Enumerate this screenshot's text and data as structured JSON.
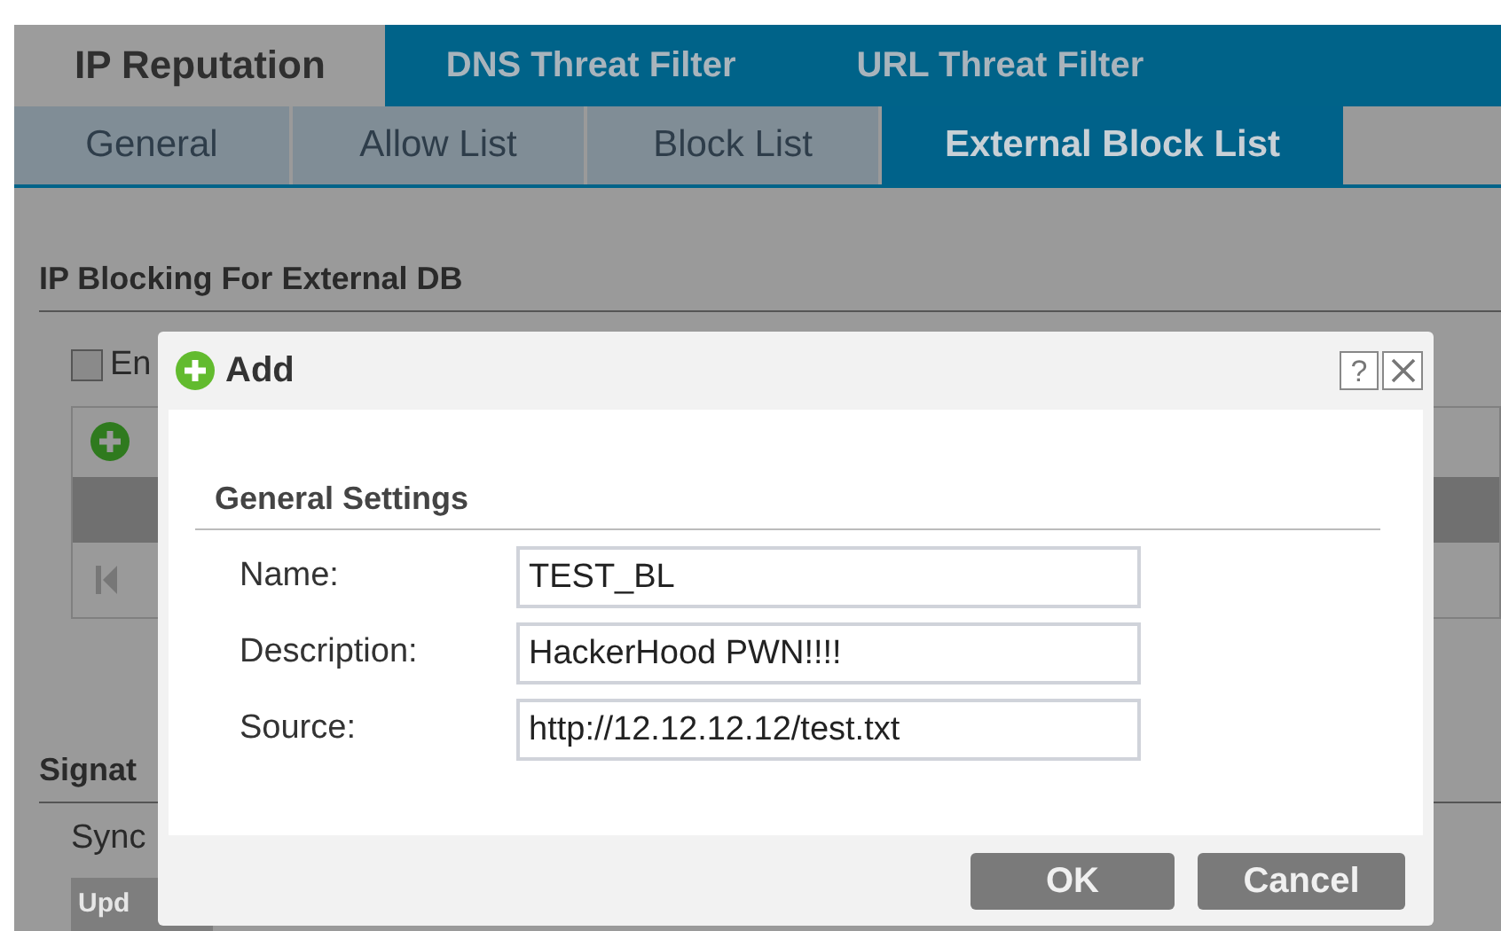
{
  "tabs": [
    {
      "label": "IP Reputation",
      "selected": true
    },
    {
      "label": "DNS Threat Filter",
      "selected": false
    },
    {
      "label": "URL Threat Filter",
      "selected": false
    }
  ],
  "subtabs": [
    {
      "label": "General",
      "selected": false
    },
    {
      "label": "Allow List",
      "selected": false
    },
    {
      "label": "Block List",
      "selected": false
    },
    {
      "label": "External Block List",
      "selected": true
    }
  ],
  "section": {
    "title": "IP Blocking For External DB",
    "enable": {
      "label": "En",
      "checked": false
    }
  },
  "section_2": {
    "title": "Signat",
    "sync_label": "Sync",
    "update_button": "Upd"
  },
  "dialog": {
    "title": "Add",
    "help": "?",
    "group_title": "General Settings",
    "fields": [
      {
        "label": "Name:",
        "value": "TEST_BL"
      },
      {
        "label": "Description:",
        "value": "HackerHood PWN!!!!"
      },
      {
        "label": "Source:",
        "value": "http://12.12.12.12/test.txt"
      }
    ],
    "buttons": [
      "OK",
      "Cancel"
    ]
  }
}
